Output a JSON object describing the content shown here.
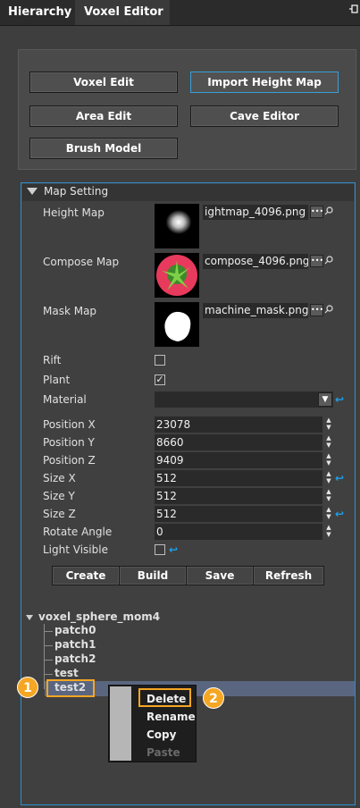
{
  "tabs": [
    {
      "label": "Hierarchy"
    },
    {
      "label": "Voxel Editor"
    }
  ],
  "toolbar": {
    "voxel_edit": "Voxel Edit",
    "import_height_map": "Import Height Map",
    "area_edit": "Area Edit",
    "cave_editor": "Cave Editor",
    "brush_model": "Brush Model"
  },
  "map_setting": {
    "title": "Map Setting",
    "height_map": {
      "label": "Height Map",
      "file": "ightmap_4096.png"
    },
    "compose_map": {
      "label": "Compose Map",
      "file": "compose_4096.png"
    },
    "mask_map": {
      "label": "Mask Map",
      "file": "machine_mask.png"
    },
    "rift": {
      "label": "Rift",
      "checked": false
    },
    "plant": {
      "label": "Plant",
      "checked": true,
      "check_mark": "✓"
    },
    "material": {
      "label": "Material",
      "value": ""
    },
    "fields": [
      {
        "label": "Position X",
        "value": "23078"
      },
      {
        "label": "Position Y",
        "value": "8660"
      },
      {
        "label": "Position Z",
        "value": "9409"
      },
      {
        "label": "Size X",
        "value": "512"
      },
      {
        "label": "Size Y",
        "value": "512"
      },
      {
        "label": "Size Z",
        "value": "512"
      },
      {
        "label": "Rotate Angle",
        "value": "0"
      }
    ],
    "light_visible": {
      "label": "Light Visible",
      "checked": false
    },
    "actions": {
      "create": "Create",
      "build": "Build",
      "save": "Save",
      "refresh": "Refresh"
    }
  },
  "tree": {
    "root": "voxel_sphere_mom4",
    "children": [
      "patch0",
      "patch1",
      "patch2",
      "test",
      "test2"
    ]
  },
  "context_menu": {
    "items": [
      {
        "label": "Delete",
        "enabled": true
      },
      {
        "label": "Rename",
        "enabled": true
      },
      {
        "label": "Copy",
        "enabled": true
      },
      {
        "label": "Paste",
        "enabled": false
      }
    ]
  },
  "annotations": {
    "badge1": "1",
    "badge2": "2"
  },
  "icons": {
    "dots": "ellipsis-icon",
    "search": "search-icon",
    "reset": "reset-icon"
  },
  "colors": {
    "accent": "#2f8fd0",
    "highlight": "#f5a623",
    "selection": "#5a6680"
  }
}
